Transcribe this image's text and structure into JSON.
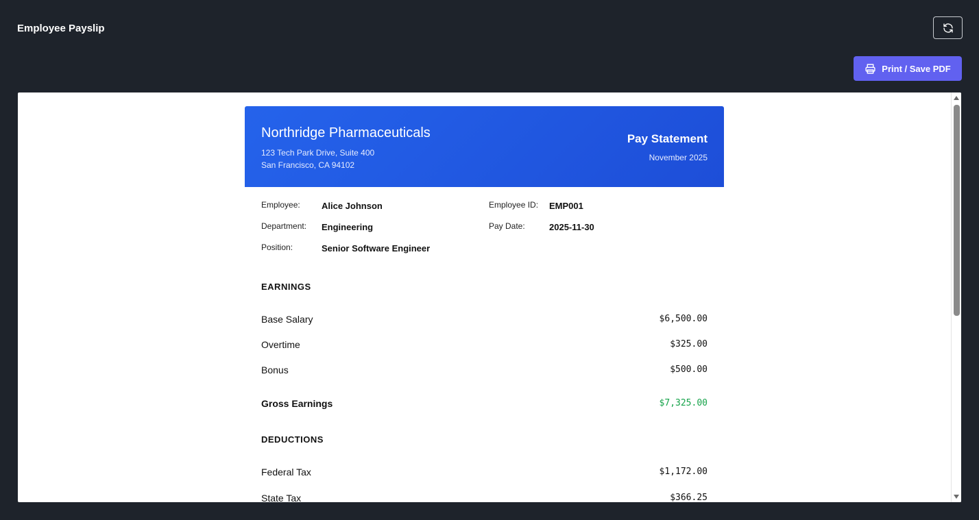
{
  "app": {
    "title": "Employee Payslip",
    "print_label": "Print / Save PDF"
  },
  "payslip": {
    "company": {
      "name": "Northridge Pharmaceuticals",
      "address_line1": "123 Tech Park Drive, Suite 400",
      "address_line2": "San Francisco, CA 94102"
    },
    "statement": {
      "title": "Pay Statement",
      "period": "November 2025"
    },
    "employee": {
      "name_label": "Employee:",
      "name": "Alice Johnson",
      "department_label": "Department:",
      "department": "Engineering",
      "position_label": "Position:",
      "position": "Senior Software Engineer",
      "id_label": "Employee ID:",
      "id": "EMP001",
      "pay_date_label": "Pay Date:",
      "pay_date": "2025-11-30"
    },
    "earnings": {
      "title": "EARNINGS",
      "items": [
        {
          "label": "Base Salary",
          "amount": "$6,500.00"
        },
        {
          "label": "Overtime",
          "amount": "$325.00"
        },
        {
          "label": "Bonus",
          "amount": "$500.00"
        }
      ],
      "total_label": "Gross Earnings",
      "total_amount": "$7,325.00"
    },
    "deductions": {
      "title": "DEDUCTIONS",
      "items": [
        {
          "label": "Federal Tax",
          "amount": "$1,172.00"
        },
        {
          "label": "State Tax",
          "amount": "$366.25"
        }
      ]
    }
  },
  "colors": {
    "background": "#1e232b",
    "header_blue": "#2563eb",
    "print_button": "#6161f0",
    "gross_green": "#16a34a"
  }
}
